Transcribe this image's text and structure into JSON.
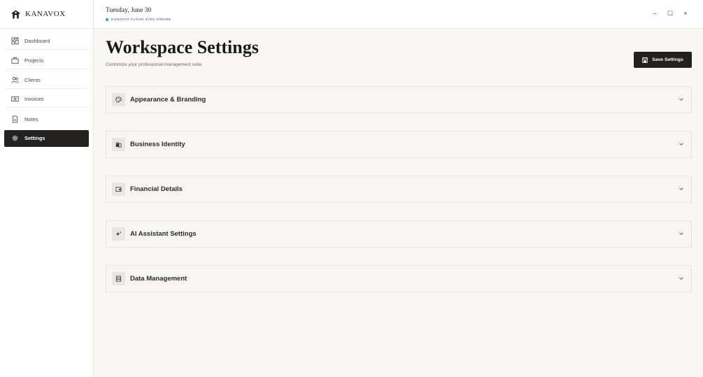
{
  "brand": {
    "name": "KANAVOX"
  },
  "sidebar": {
    "items": [
      {
        "label": "Dashboard",
        "icon": "dashboard-icon",
        "active": false
      },
      {
        "label": "Projects",
        "icon": "briefcase-icon",
        "active": false
      },
      {
        "label": "Clients",
        "icon": "users-icon",
        "active": false
      },
      {
        "label": "Invoices",
        "icon": "banknote-icon",
        "active": false
      },
      {
        "label": "Notes",
        "icon": "file-icon",
        "active": false
      },
      {
        "label": "Settings",
        "icon": "gear-icon",
        "active": true
      }
    ]
  },
  "header": {
    "date": "Tuesday, June 30",
    "sync_status": "KANAVOX CLOUD SYNC ENGINE",
    "sync_color": "#22b07a",
    "window_controls": {
      "minimize": "–",
      "maximize": "☐",
      "close": "×"
    }
  },
  "main": {
    "title": "Workspace Settings",
    "subtitle": "Customize your professional management suite.",
    "save_label": "Save Settings",
    "sections": [
      {
        "title": "Appearance & Branding",
        "icon": "palette-icon"
      },
      {
        "title": "Business Identity",
        "icon": "building-icon"
      },
      {
        "title": "Financial Details",
        "icon": "wallet-icon"
      },
      {
        "title": "AI Assistant Settings",
        "icon": "sparkles-icon"
      },
      {
        "title": "Data Management",
        "icon": "database-icon"
      }
    ]
  },
  "colors": {
    "accent": "#22211f",
    "background": "#f8f7f3",
    "panel": "#ffffff"
  }
}
